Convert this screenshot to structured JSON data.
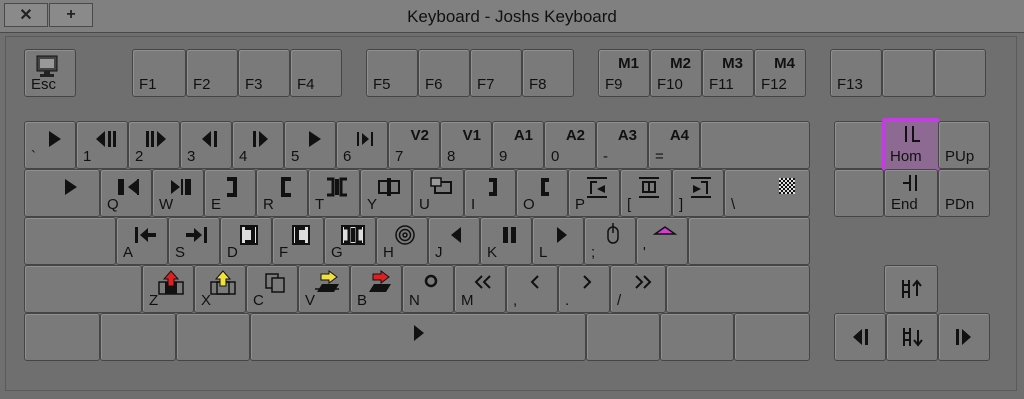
{
  "window": {
    "title": "Keyboard - Joshs Keyboard",
    "close_label": "✕",
    "add_label": "+"
  },
  "keys": {
    "esc": "Esc",
    "f1": "F1",
    "f2": "F2",
    "f3": "F3",
    "f4": "F4",
    "f5": "F5",
    "f6": "F6",
    "f7": "F7",
    "f8": "F8",
    "f9": "F9",
    "f9_top": "M1",
    "f10": "F10",
    "f10_top": "M2",
    "f11": "F11",
    "f11_top": "M3",
    "f12": "F12",
    "f12_top": "M4",
    "f13": "F13",
    "backtick": "`",
    "n1": "1",
    "n2": "2",
    "n3": "3",
    "n4": "4",
    "n5": "5",
    "n6": "6",
    "n7": "7",
    "n7_top": "V2",
    "n8": "8",
    "n8_top": "V1",
    "n9": "9",
    "n9_top": "A1",
    "n0": "0",
    "n0_top": "A2",
    "minus": "-",
    "minus_top": "A3",
    "equal": "=",
    "equal_top": "A4",
    "q": "Q",
    "w": "W",
    "e": "E",
    "r": "R",
    "t": "T",
    "y": "Y",
    "u": "U",
    "i": "I",
    "o": "O",
    "p": "P",
    "lbr": "[",
    "rbr": "]",
    "bslash": "\\",
    "a": "A",
    "s": "S",
    "d": "D",
    "f": "F",
    "g": "G",
    "h": "H",
    "j": "J",
    "k": "K",
    "l": "L",
    "semi": ";",
    "quote": "'",
    "z": "Z",
    "x": "X",
    "c": "C",
    "v": "V",
    "b": "B",
    "n": "N",
    "m": "M",
    "comma": ",",
    "period": ".",
    "slash": "/",
    "home": "Hom",
    "pgup": "PUp",
    "end": "End",
    "pgdn": "PDn"
  },
  "colors": {
    "selected": "#c23ee0",
    "red": "#e02020",
    "yellow": "#f0e040",
    "magenta": "#d040d0"
  },
  "icons": {
    "esc": "monitor-icon",
    "home": "go-to-start-icon",
    "end": "go-to-end-icon"
  }
}
